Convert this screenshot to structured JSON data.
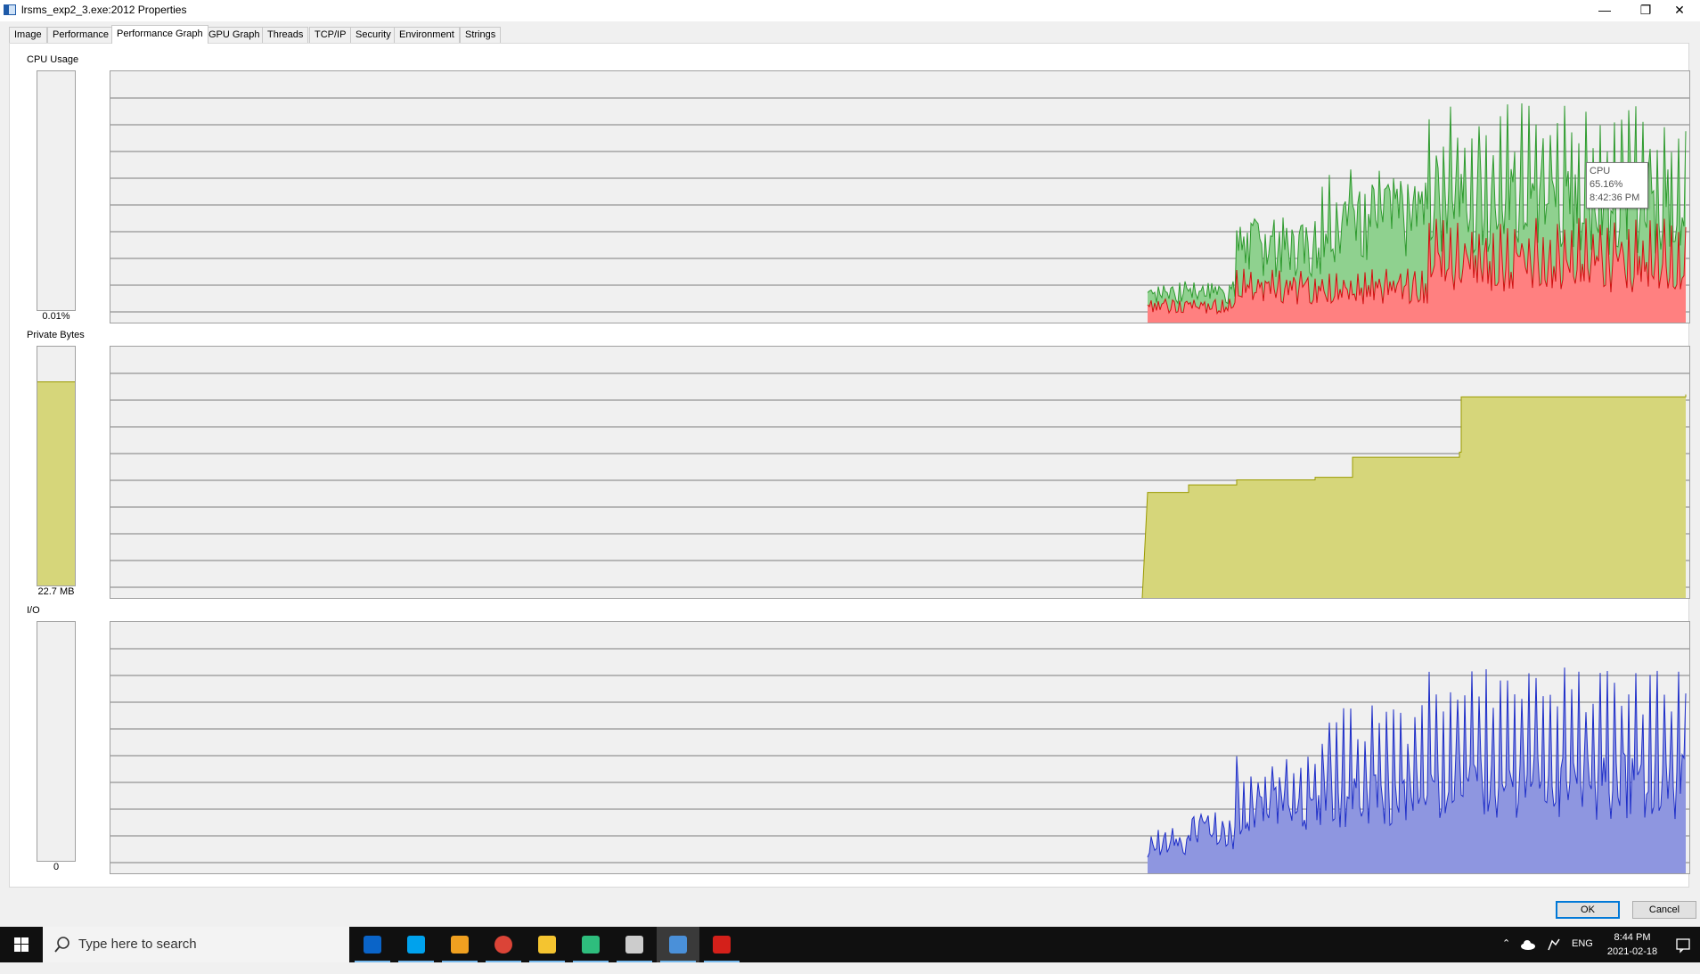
{
  "window": {
    "title": "lrsms_exp2_3.exe:2012 Properties",
    "controls": {
      "minimize": "—",
      "restore": "❐",
      "close": "✕"
    }
  },
  "tabs": [
    {
      "label": "Image",
      "active": false
    },
    {
      "label": "Performance",
      "active": false
    },
    {
      "label": "Performance Graph",
      "active": true
    },
    {
      "label": "GPU Graph",
      "active": false
    },
    {
      "label": "Threads",
      "active": false
    },
    {
      "label": "TCP/IP",
      "active": false
    },
    {
      "label": "Security",
      "active": false
    },
    {
      "label": "Environment",
      "active": false
    },
    {
      "label": "Strings",
      "active": false
    }
  ],
  "sections": {
    "cpu": {
      "label": "CPU Usage",
      "value": "0.01%",
      "meter_level": 0.0,
      "colors": {
        "total": "#2e9a2e",
        "total_fill": "#8fd18f",
        "kernel": "#d01010",
        "kernel_fill": "#ff8080"
      }
    },
    "private_bytes": {
      "label": "Private Bytes",
      "value": "22.7 MB",
      "meter_level": 0.85,
      "colors": {
        "line": "#9a9a00",
        "fill": "#d6d67a"
      }
    },
    "io": {
      "label": "I/O",
      "value": "0",
      "meter_level": 0.0,
      "colors": {
        "line": "#1e2ec8",
        "fill": "#8e96e0"
      }
    }
  },
  "tooltip": {
    "series": "CPU",
    "value": "65.16%",
    "time": "8:42:36 PM"
  },
  "buttons": {
    "ok": "OK",
    "cancel": "Cancel"
  },
  "taskbar": {
    "search_placeholder": "Type here to search",
    "apps": [
      {
        "icon": "mail-icon",
        "color": "#0a64c8"
      },
      {
        "icon": "skype-icon",
        "color": "#00a2ed"
      },
      {
        "icon": "sublime-icon",
        "color": "#f0a020"
      },
      {
        "icon": "chrome-icon",
        "color": "#db4437"
      },
      {
        "icon": "file-explorer-icon",
        "color": "#f4c430"
      },
      {
        "icon": "vpn-icon",
        "color": "#2ebd7d"
      },
      {
        "icon": "terminal-icon",
        "color": "#cccccc"
      },
      {
        "icon": "process-explorer-icon",
        "color": "#4a90d9"
      },
      {
        "icon": "acrobat-icon",
        "color": "#d4201a"
      }
    ],
    "language": "ENG",
    "time": "8:44 PM",
    "date": "2021-02-18"
  }
}
